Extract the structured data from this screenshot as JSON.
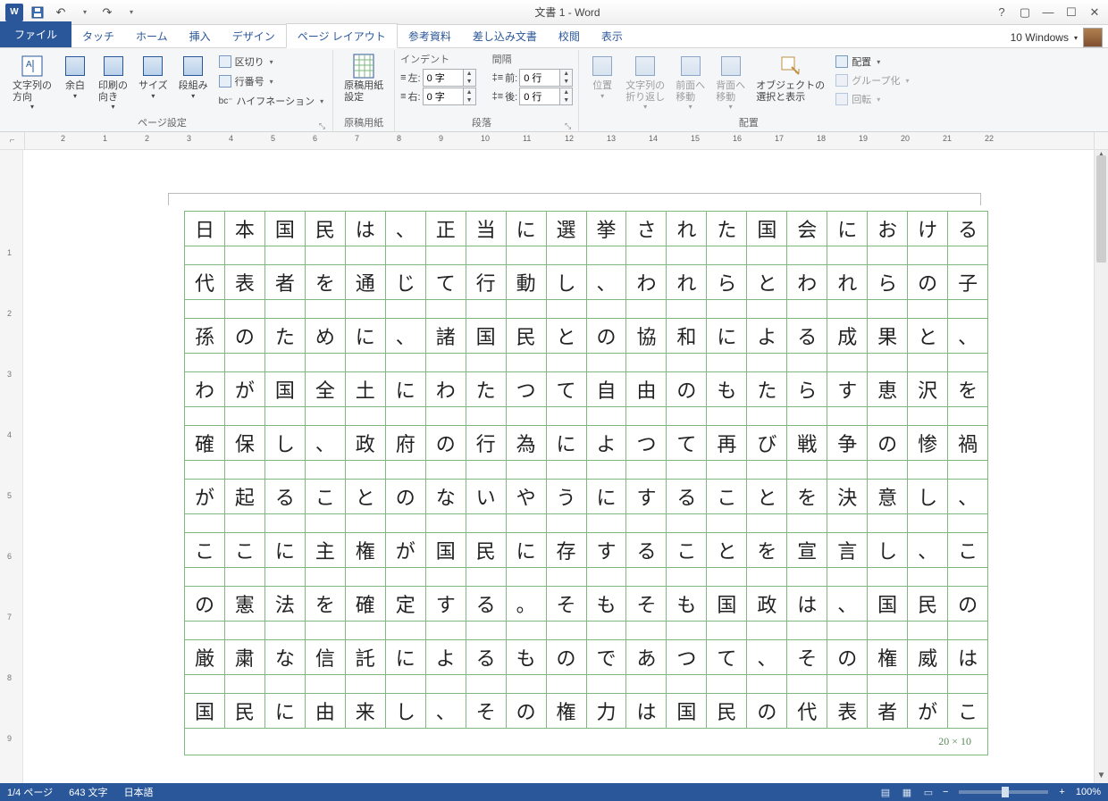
{
  "title": "文書 1 - Word",
  "user": "10 Windows",
  "qat": {
    "save": "save",
    "undo": "undo",
    "redo": "redo"
  },
  "tabs": {
    "file": "ファイル",
    "items": [
      "タッチ",
      "ホーム",
      "挿入",
      "デザイン",
      "ページ レイアウト",
      "参考資料",
      "差し込み文書",
      "校閲",
      "表示"
    ],
    "active_index": 4
  },
  "ribbon": {
    "page_setup": {
      "text_dir": "文字列の\n方向",
      "margins": "余白",
      "orientation": "印刷の\n向き",
      "size": "サイズ",
      "columns": "段組み",
      "breaks": "区切り",
      "line_no": "行番号",
      "hyphen": "ハイフネーション",
      "label": "ページ設定"
    },
    "genkou": {
      "btn": "原稿用紙\n設定",
      "label": "原稿用紙"
    },
    "paragraph": {
      "indent_hdr": "インデント",
      "left": "左:",
      "right": "右:",
      "spacing_hdr": "間隔",
      "before": "前:",
      "after": "後:",
      "indent_val": "0 字",
      "space_val": "0 行",
      "label": "段落"
    },
    "arrange": {
      "position": "位置",
      "wrap": "文字列の\n折り返し",
      "front": "前面へ\n移動",
      "back": "背面へ\n移動",
      "select": "オブジェクトの\n選択と表示",
      "align": "配置",
      "group": "グループ化",
      "rotate": "回転",
      "label": "配置"
    }
  },
  "ruler_h": [
    2,
    1,
    2,
    3,
    4,
    5,
    6,
    7,
    8,
    9,
    10,
    11,
    12,
    13,
    14,
    15,
    16,
    17,
    18,
    19,
    20,
    21,
    22
  ],
  "ruler_v": [
    1,
    2,
    3,
    4,
    5,
    6,
    7,
    8,
    9
  ],
  "grid": {
    "rows": [
      "日本国民は、正当に選挙された国会における",
      "代表者を通じて行動し、われらとわれらの子",
      "孫のために、諸国民との協和による成果と、",
      "わが国全土にわたつて自由のもたらす恵沢を",
      "確保し、政府の行為によつて再び戦争の惨禍",
      "が起ることのないやうにすることを決意し、",
      "ここに主権が国民に存することを宣言し、こ",
      "の憲法を確定する。そもそも国政は、国民の",
      "厳粛な信託によるものであつて、その権威は",
      "国民に由来し、その権力は国民の代表者がこ"
    ],
    "footer": "20 × 10"
  },
  "status": {
    "page": "1/4 ページ",
    "words": "643 文字",
    "lang": "日本語",
    "zoom": "100%"
  }
}
